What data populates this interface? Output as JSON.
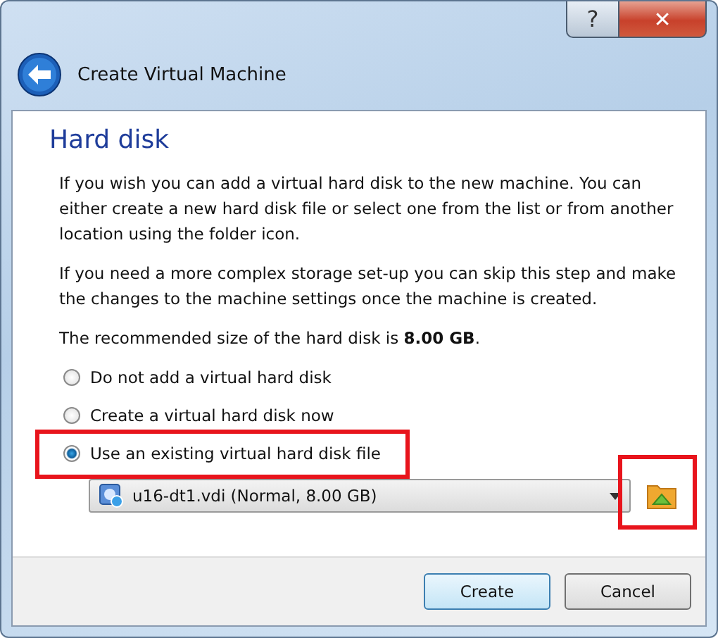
{
  "window": {
    "title": "Create Virtual Machine",
    "caption_buttons": [
      "?",
      "✕"
    ]
  },
  "page": {
    "heading": "Hard disk",
    "paragraphs": [
      "If you wish you can add a virtual hard disk to the new machine. You can either create a new hard disk file or select one from the list or from another location using the folder icon.",
      "If you need a more complex storage set-up you can skip this step and make the changes to the machine settings once the machine is created.",
      "The recommended size of the hard disk is **8.00 GB**."
    ],
    "options": [
      {
        "label": "Do not add a virtual hard disk",
        "selected": false,
        "highlighted": false
      },
      {
        "label": "Create a virtual hard disk now",
        "selected": false,
        "highlighted": false
      },
      {
        "label": "Use an existing virtual hard disk file",
        "selected": true,
        "highlighted": true
      }
    ],
    "disk_select": {
      "value": "u16-dt1.vdi (Normal, 8.00 GB)"
    },
    "folder_button": {
      "highlighted": true
    }
  },
  "buttons": [
    {
      "label": "Create",
      "default": true
    },
    {
      "label": "Cancel",
      "default": false
    }
  ]
}
